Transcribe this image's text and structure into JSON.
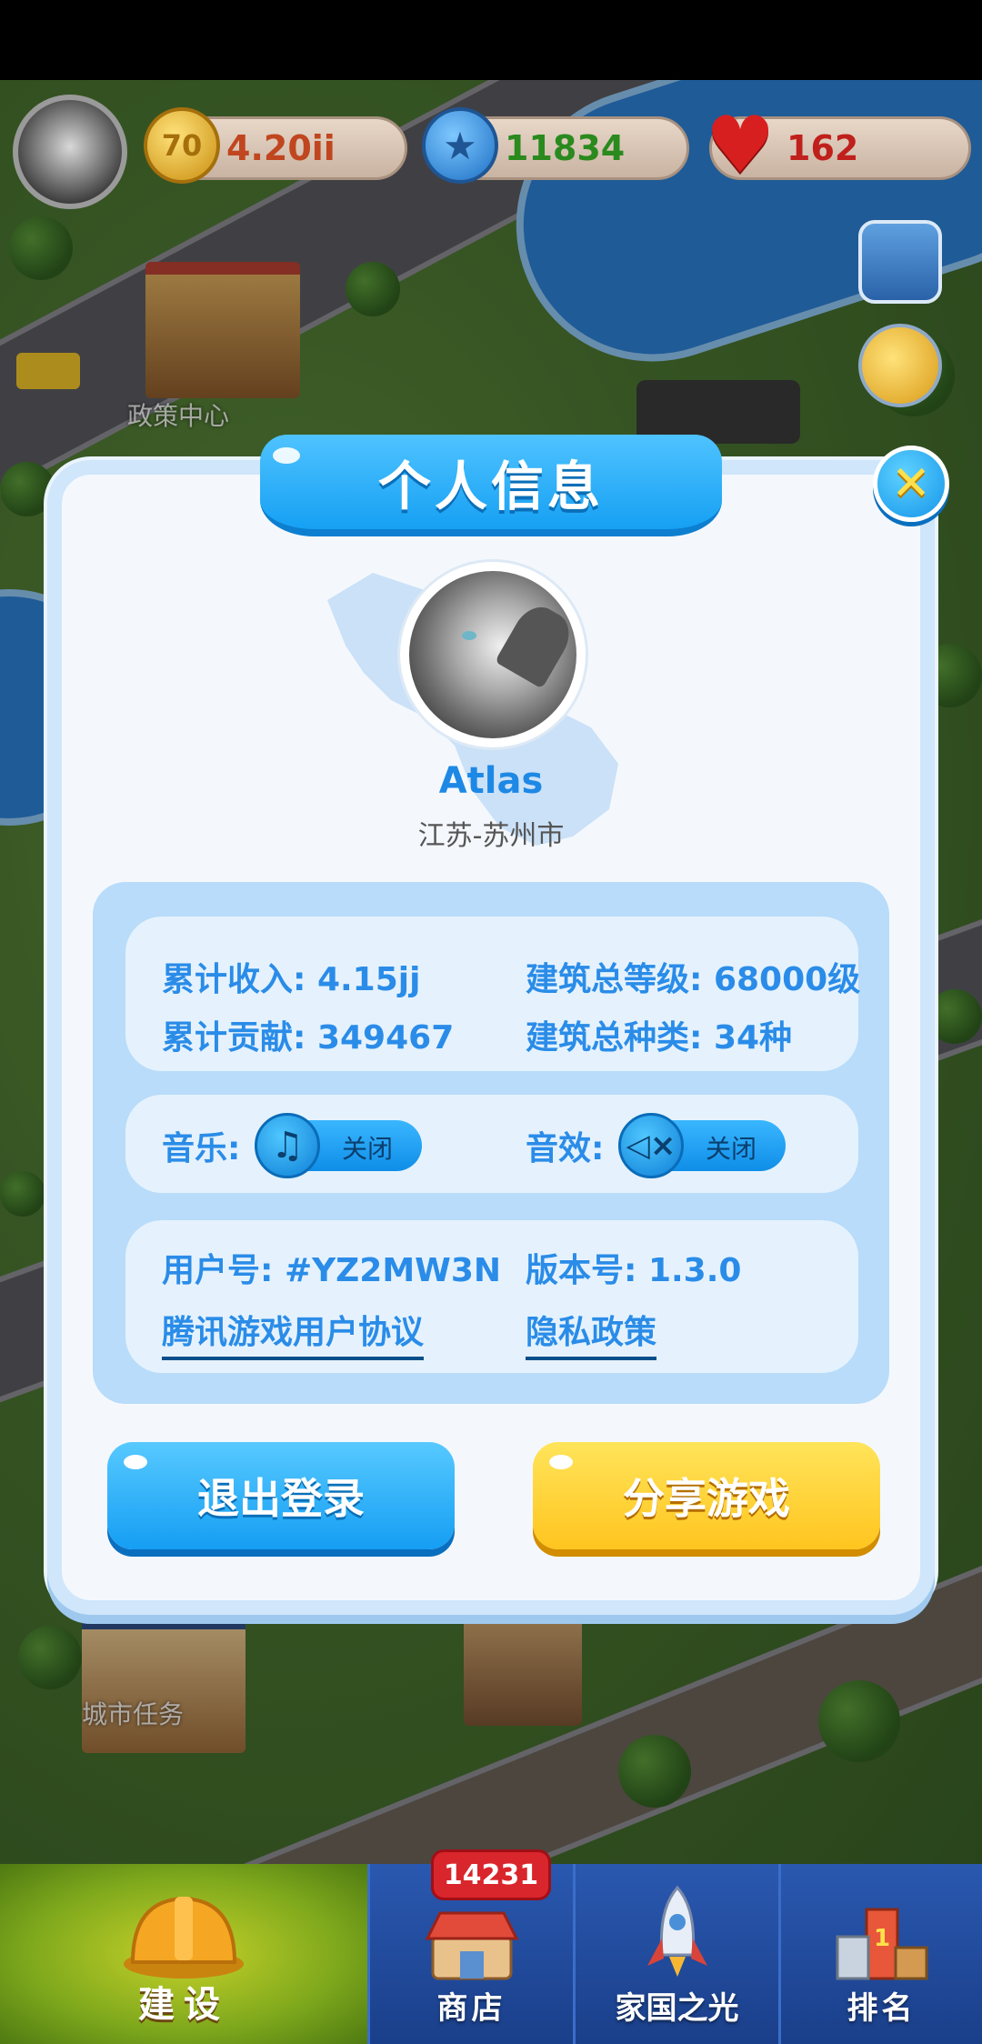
{
  "hud": {
    "coins": "4.20ii",
    "coin_icon_text": "70",
    "stars": "11834",
    "hearts": "162"
  },
  "map_labels": [
    "政策中心",
    "城市任务"
  ],
  "modal": {
    "title": "个人信息",
    "close_icon": "close-icon",
    "player_name": "Atlas",
    "location": "江苏-苏州市",
    "stats": {
      "income_label": "累计收入:",
      "income_value": "4.15jj",
      "contribution_label": "累计贡献:",
      "contribution_value": "349467",
      "building_level_label": "建筑总等级:",
      "building_level_value": "68000级",
      "building_types_label": "建筑总种类:",
      "building_types_value": "34种"
    },
    "settings": {
      "music_label": "音乐:",
      "music_state": "关闭",
      "sound_label": "音效:",
      "sound_state": "关闭"
    },
    "account": {
      "user_id_label": "用户号:",
      "user_id_value": "#YZ2MW3N",
      "version_label": "版本号:",
      "version_value": "1.3.0",
      "agreement_link": "腾讯游戏用户协议",
      "privacy_link": "隐私政策"
    },
    "buttons": {
      "logout": "退出登录",
      "share": "分享游戏"
    }
  },
  "bottom_nav": {
    "build": "建设",
    "shop": "商店",
    "shop_badge": "14231",
    "homeland": "家国之光",
    "rank": "排名"
  },
  "colors": {
    "accent_blue": "#16a0f3",
    "accent_yellow": "#ffc51f",
    "text_blue": "#2a8ce8"
  }
}
